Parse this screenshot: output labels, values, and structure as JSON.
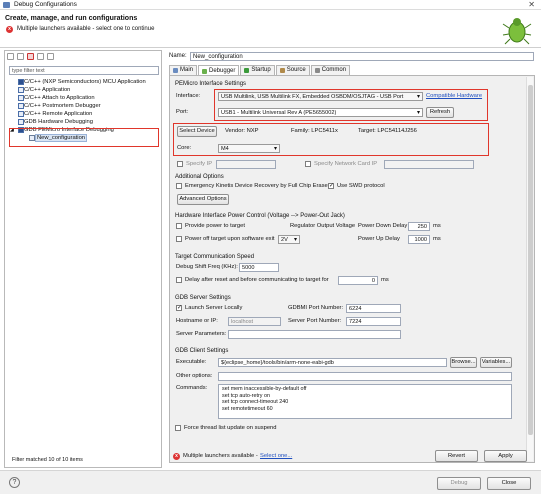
{
  "window": {
    "title": "Debug Configurations"
  },
  "header": {
    "title": "Create, manage, and run configurations",
    "message": "Multiple launchers available - select one to continue"
  },
  "left": {
    "filter_placeholder": "type filter text",
    "tree": [
      {
        "label": "C/C++ (NXP Semiconductors) MCU Application",
        "level": 0
      },
      {
        "label": "C/C++ Application",
        "level": 0
      },
      {
        "label": "C/C++ Attach to Application",
        "level": 0
      },
      {
        "label": "C/C++ Postmortem Debugger",
        "level": 0
      },
      {
        "label": "C/C++ Remote Application",
        "level": 0
      },
      {
        "label": "GDB Hardware Debugging",
        "level": 0
      },
      {
        "label": "GDB PEMicro Interface Debugging",
        "level": 0,
        "expanded": true
      },
      {
        "label": "New_configuration",
        "level": 1,
        "selected": true
      }
    ],
    "status": "Filter matched 10 of 10 items"
  },
  "config": {
    "name_label": "Name:",
    "name_value": "New_configuration",
    "tabs": [
      "Main",
      "Debugger",
      "Startup",
      "Source",
      "Common"
    ],
    "active_tab": "Debugger"
  },
  "pemicro": {
    "section": "PEMicro Interface Settings",
    "interface_label": "Interface:",
    "interface_value": "USB Multilink, USB Multilink FX, Embedded OSBDM/OSJTAG - USB Port",
    "compatible_link": "Compatible Hardware",
    "port_label": "Port:",
    "port_value": "USB1 - Multilink Universal Rev A (PE5655002)",
    "refresh": "Refresh",
    "select_device": "Select Device",
    "vendor": "Vendor: NXP",
    "family": "Family: LPC5411x",
    "target": "Target: LPC54114J256",
    "core_label": "Core:",
    "core_value": "M4",
    "specify_ip": "Specify IP",
    "specify_network": "Specify Network Card IP"
  },
  "additional": {
    "section": "Additional Options",
    "emergency": "Emergency Kinetis Device Recovery by Full Chip Erase",
    "use_swd": "Use SWD protocol",
    "advanced": "Advanced Options"
  },
  "power": {
    "section": "Hardware Interface Power Control (Voltage --> Power-Out Jack)",
    "provide": "Provide power to target",
    "reg_label": "Regulator Output Voltage",
    "power_down_label": "Power Down Delay",
    "power_down_value": "250",
    "unit": "ms",
    "power_off": "Power off target upon software exit",
    "voltage": "2V",
    "power_up_label": "Power Up Delay",
    "power_up_value": "1000"
  },
  "comm": {
    "section": "Target Communication Speed",
    "shift_label": "Debug Shift Freq (KHz):",
    "shift_value": "5000",
    "delay_label": "Delay after reset and before communicating to target for",
    "delay_value": "0",
    "unit": "ms"
  },
  "server": {
    "section": "GDB Server Settings",
    "launch": "Launch Server Locally",
    "gdbmi_label": "GDBMI Port Number:",
    "gdbmi_value": "6224",
    "host_label": "Hostname or IP:",
    "host_value": "localhost",
    "port_label": "Server Port Number:",
    "port_value": "7224",
    "params_label": "Server Parameters:"
  },
  "client": {
    "section": "GDB Client Settings",
    "exe_label": "Executable:",
    "exe_value": "${eclipse_home}/tools/bin/arm-none-eabi-gdb",
    "browse": "Browse...",
    "variables": "Variables...",
    "other_label": "Other options:",
    "commands_label": "Commands:",
    "commands": [
      "set mem inaccessible-by-default off",
      "set tcp auto-retry on",
      "set tcp connect-timeout 240",
      "set remotetimeout 60"
    ]
  },
  "force_thread": "Force thread list update on suspend",
  "bottom": {
    "message": "Multiple launchers available -",
    "select_link": "Select one...",
    "revert": "Revert",
    "apply": "Apply"
  },
  "footer": {
    "help": "?",
    "debug": "Debug",
    "close": "Close"
  }
}
